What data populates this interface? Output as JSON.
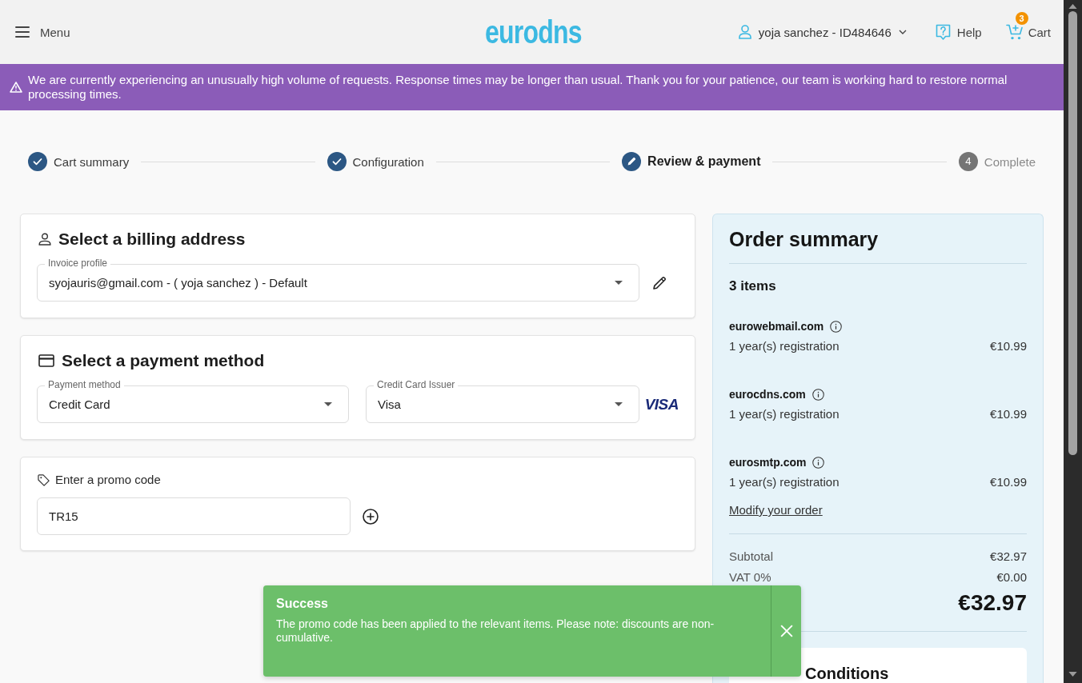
{
  "header": {
    "menu_label": "Menu",
    "logo": "eurodns",
    "account": "yoja sanchez - ID484646",
    "help": "Help",
    "cart": {
      "label": "Cart",
      "count": "3"
    }
  },
  "notice": "We are currently experiencing an unusually high volume of requests. Response times may be longer than usual. Thank you for your patience, our team is working hard to restore normal processing times.",
  "steps": [
    {
      "label": "Cart summary",
      "completed": true,
      "current": false
    },
    {
      "label": "Configuration",
      "completed": true,
      "current": false
    },
    {
      "label": "Review & payment",
      "completed": false,
      "current": true
    },
    {
      "label": "Complete",
      "completed": false,
      "current": false,
      "number": "4"
    }
  ],
  "billing": {
    "title": "Select a billing address",
    "field": {
      "label": "Invoice profile",
      "value": "syojauris@gmail.com - ( yoja sanchez ) - Default"
    }
  },
  "payment": {
    "title": "Select a payment method",
    "fields": [
      {
        "label": "Payment method",
        "value": "Credit Card"
      },
      {
        "label": "Credit Card Issuer",
        "value": "Visa"
      }
    ],
    "card_brand": "VISA"
  },
  "promo": {
    "label": "Enter a promo code",
    "value": "TR15"
  },
  "order_summary": {
    "title": "Order summary",
    "count": "3 items",
    "items": [
      {
        "name": "eurowebmail.com",
        "description": "1 year(s) registration",
        "price": "€10.99"
      },
      {
        "name": "eurocdns.com",
        "description": "1 year(s) registration",
        "price": "€10.99"
      },
      {
        "name": "eurosmtp.com",
        "description": "1 year(s) registration",
        "price": "€10.99"
      }
    ],
    "modify_link": "Modify your order",
    "subtotal": {
      "label": "Subtotal",
      "value": "€32.97"
    },
    "vat": {
      "label": "VAT 0%",
      "value": "€0.00"
    },
    "total": "€32.97",
    "terms_title": "Conditions"
  },
  "toast": {
    "title": "Success",
    "message": "The promo code has been applied to the relevant items. Please note: discounts are non-cumulative."
  }
}
